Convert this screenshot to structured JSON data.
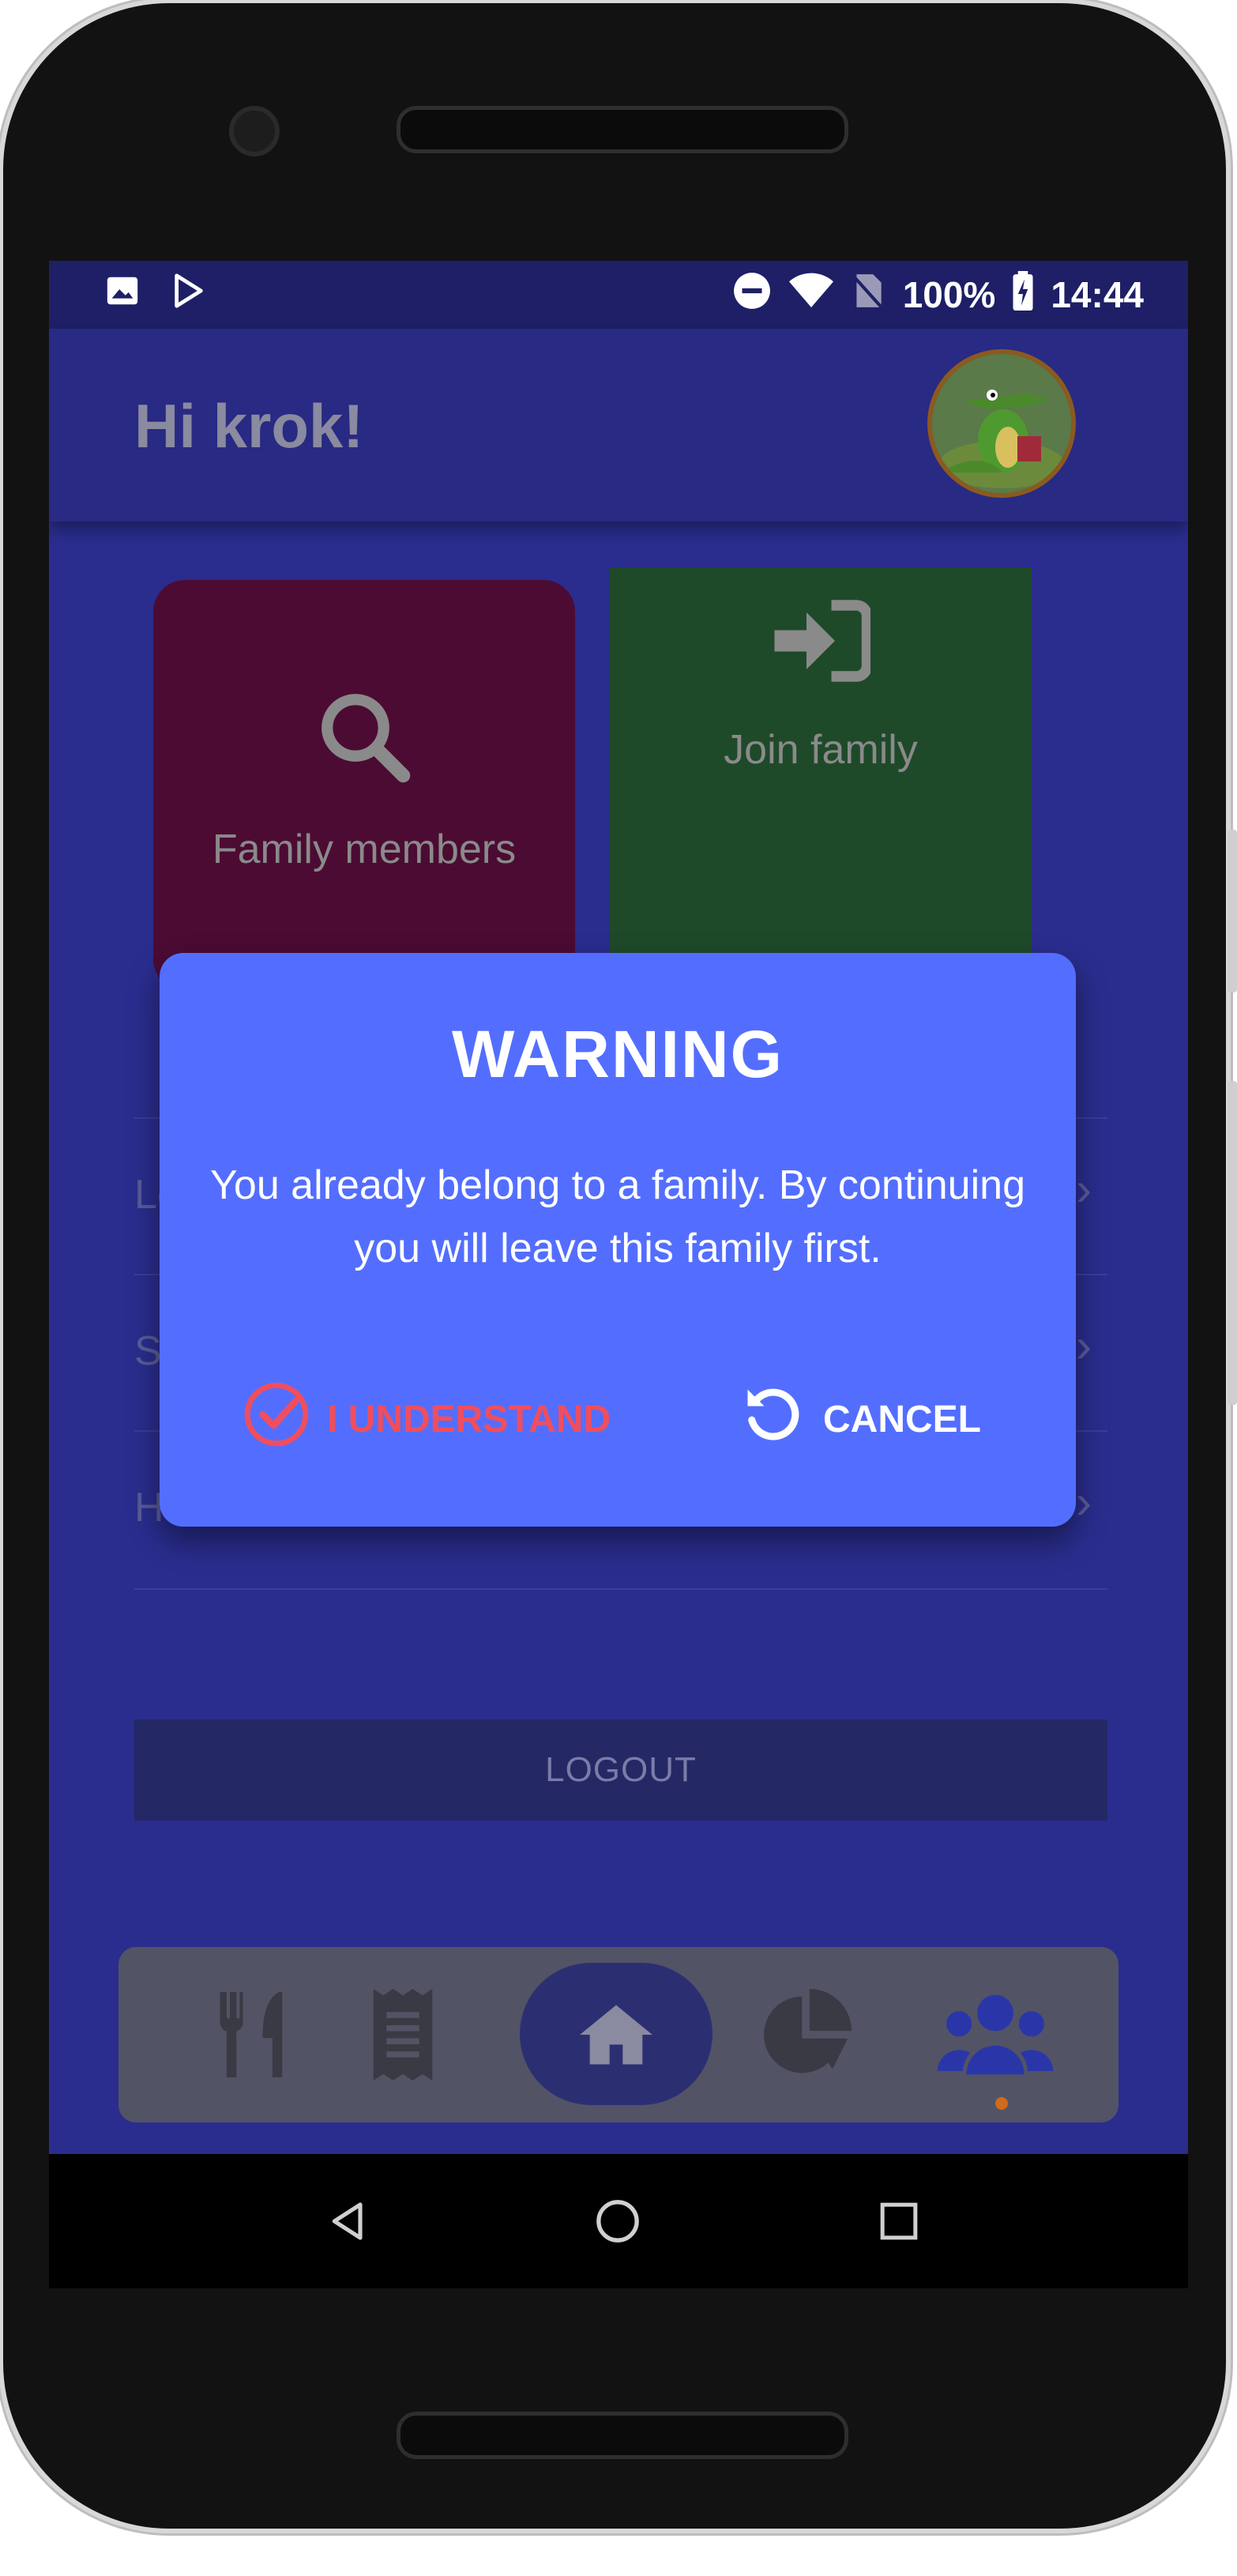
{
  "status_bar": {
    "battery": "100%",
    "time": "14:44",
    "left_icons": [
      "image-icon",
      "play-store-icon"
    ],
    "right_icons": [
      "dnd-icon",
      "wifi-icon",
      "no-sim-icon",
      "battery-charging-icon"
    ]
  },
  "header": {
    "greeting": "Hi krok!",
    "avatar": "crocodile-avatar"
  },
  "tiles": [
    {
      "label": "Family members",
      "icon": "search-icon",
      "color": "#4c0b33"
    },
    {
      "label": "Join family",
      "icon": "sign-in-icon",
      "color": "#1e4a2a"
    }
  ],
  "menu": {
    "items": [
      {
        "label": "Le"
      },
      {
        "label": "Se"
      },
      {
        "label": "He"
      }
    ]
  },
  "logout_label": "LOGOUT",
  "bottom_nav": {
    "items": [
      "utensils-icon",
      "receipt-icon",
      "home-icon",
      "pie-chart-icon",
      "users-icon"
    ],
    "active": "users-icon"
  },
  "dialog": {
    "title": "WARNING",
    "message": "You already belong to a family. By continuing you will leave this family first.",
    "confirm_label": "I UNDERSTAND",
    "cancel_label": "CANCEL",
    "background": "#536eff",
    "confirm_color": "#f04e5e"
  }
}
